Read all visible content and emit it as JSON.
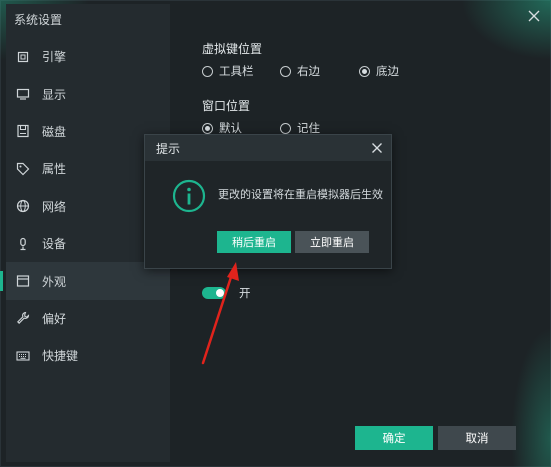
{
  "window": {
    "title": "系统设置"
  },
  "sidebar": {
    "items": [
      {
        "label": "引擎",
        "icon": "chip-icon"
      },
      {
        "label": "显示",
        "icon": "monitor-icon"
      },
      {
        "label": "磁盘",
        "icon": "disk-icon"
      },
      {
        "label": "属性",
        "icon": "tag-icon"
      },
      {
        "label": "网络",
        "icon": "globe-icon"
      },
      {
        "label": "设备",
        "icon": "microphone-icon"
      },
      {
        "label": "外观",
        "icon": "window-icon",
        "active": true
      },
      {
        "label": "偏好",
        "icon": "wrench-icon"
      },
      {
        "label": "快捷键",
        "icon": "keyboard-icon"
      }
    ]
  },
  "settings": {
    "virtual_key_position": {
      "title": "虚拟键位置",
      "options": [
        "工具栏",
        "右边",
        "底边"
      ],
      "selected": "底边"
    },
    "window_position": {
      "title": "窗口位置",
      "options": [
        "默认",
        "记住"
      ],
      "selected": "默认"
    },
    "toggle": {
      "state_label": "开",
      "on": true
    }
  },
  "footer": {
    "confirm_label": "确定",
    "cancel_label": "取消"
  },
  "modal": {
    "title": "提示",
    "message": "更改的设置将在重启模拟器后生效",
    "restart_later_label": "稍后重启",
    "restart_now_label": "立即重启"
  },
  "colors": {
    "accent": "#1db58f",
    "arrow": "#e0231c",
    "background": "#1d2326"
  }
}
